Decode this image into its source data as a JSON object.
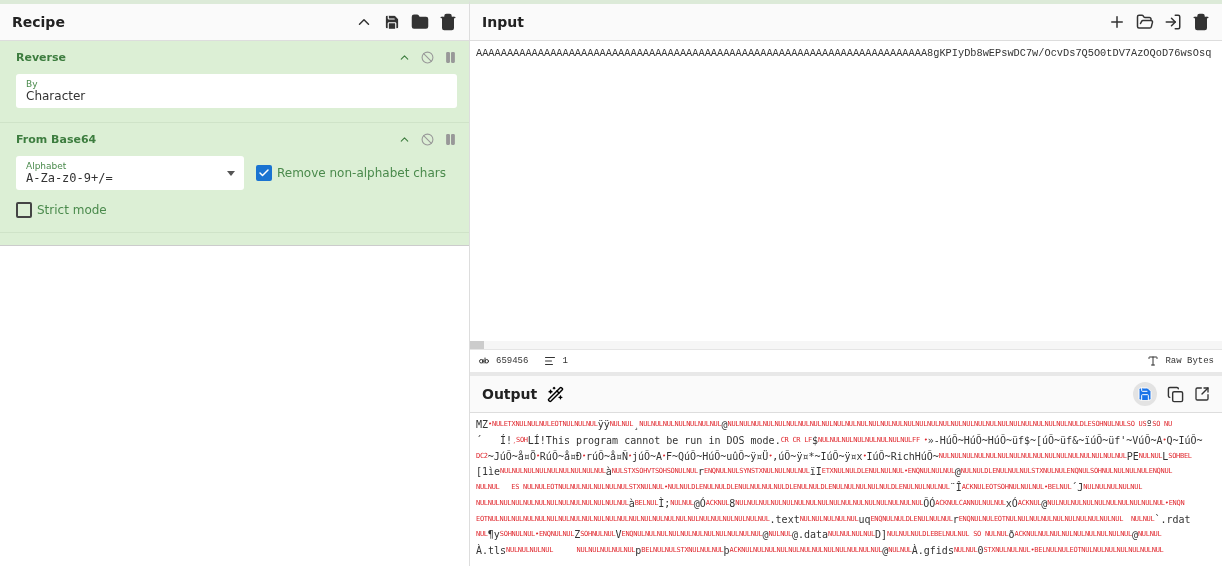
{
  "recipe": {
    "title": "Recipe",
    "operations": [
      {
        "name": "Reverse",
        "args": [
          {
            "kind": "text",
            "label": "By",
            "value": "Character"
          }
        ]
      },
      {
        "name": "From Base64",
        "args": [
          {
            "kind": "select",
            "label": "Alphabet",
            "value": "A-Za-z0-9+/="
          },
          {
            "kind": "checkbox",
            "label": "Remove non-alphabet chars",
            "checked": true
          },
          {
            "kind": "checkbox",
            "label": "Strict mode",
            "checked": false
          }
        ]
      }
    ]
  },
  "input": {
    "title": "Input",
    "value": "AAAAAAAAAAAAAAAAAAAAAAAAAAAAAAAAAAAAAAAAAAAAAAAAAAAAAAAAAAAAAAAAAAAAAAAAA8gKPIyDb8wEPswDC7w/OcvDs7Q5O0tDV7AzOQoD76wsOsq",
    "length": "659456",
    "lines": "1",
    "encoding": "Raw Bytes"
  },
  "output": {
    "title": "Output",
    "lines": [
      [
        {
          "kind": "text",
          "text": "MZ"
        },
        {
          "kind": "ctrl",
          "text": "•NULETXNULNULNULEOTNULNULNUL"
        },
        {
          "kind": "text",
          "text": "ÿÿ"
        },
        {
          "kind": "ctrl",
          "text": "NULNUL"
        },
        {
          "kind": "text",
          "text": "¸"
        },
        {
          "kind": "ctrl",
          "text": "NULNULNULNULNULNULNUL"
        },
        {
          "kind": "text",
          "text": "@"
        },
        {
          "kind": "ctrl",
          "text": "NULNULNULNULNULNULNULNULNULNULNULNULNULNULNULNULNULNULNULNULNULNULNULNULNULNULNULNULNULNULDLESOHNULNULSO US"
        },
        {
          "kind": "text",
          "text": "º"
        },
        {
          "kind": "ctrl",
          "text": "SO NU"
        }
      ],
      [
        {
          "kind": "text",
          "text": "´   Í!"
        },
        {
          "kind": "ctrl",
          "text": "¸SOH"
        },
        {
          "kind": "text",
          "text": "LÍ!This program cannot be run in DOS mode."
        },
        {
          "kind": "ctrl",
          "text": "CR CR LF"
        },
        {
          "kind": "text",
          "text": "$"
        },
        {
          "kind": "ctrl",
          "text": "NULNULNULNULNULNULNULNULFF •"
        },
        {
          "kind": "text",
          "text": "»-HúÕ~HúÕ~HúÕ~üf$~[úÕ~üf&~ïúÕ~üf'~VúÕ~A"
        },
        {
          "kind": "ctrl",
          "text": "•"
        },
        {
          "kind": "text",
          "text": "Q~IúÕ~"
        }
      ],
      [
        {
          "kind": "ctrl",
          "text": "DC2"
        },
        {
          "kind": "text",
          "text": "~JúÕ~å¤Ö"
        },
        {
          "kind": "ctrl",
          "text": "•"
        },
        {
          "kind": "text",
          "text": "RúÕ~å¤Ð"
        },
        {
          "kind": "ctrl",
          "text": "•"
        },
        {
          "kind": "text",
          "text": "rúÕ~å¤Ñ"
        },
        {
          "kind": "ctrl",
          "text": "•"
        },
        {
          "kind": "text",
          "text": "júÕ~A"
        },
        {
          "kind": "ctrl",
          "text": "•"
        },
        {
          "kind": "text",
          "text": "F~QúÕ~HúÕ~uûÕ~ÿ¤Ü"
        },
        {
          "kind": "ctrl",
          "text": "•"
        },
        {
          "kind": "text",
          "text": ",úÕ~ÿ¤*~IúÕ~ÿ¤x"
        },
        {
          "kind": "ctrl",
          "text": "•"
        },
        {
          "kind": "text",
          "text": "IúÕ~RichHúÕ~"
        },
        {
          "kind": "ctrl",
          "text": "NULNULNULNULNULNULNULNULNULNULNULNULNULNULNULNUL"
        },
        {
          "kind": "text",
          "text": "PE"
        },
        {
          "kind": "ctrl",
          "text": "NULNUL"
        },
        {
          "kind": "text",
          "text": "L"
        },
        {
          "kind": "ctrl",
          "text": "SOHBEL"
        }
      ],
      [
        {
          "kind": "text",
          "text": "[1ìe"
        },
        {
          "kind": "ctrl",
          "text": "NULNULNULNULNULNULNULNULNUL"
        },
        {
          "kind": "text",
          "text": "à"
        },
        {
          "kind": "ctrl",
          "text": "NULSTXSOHVTSOHSONULNUL"
        },
        {
          "kind": "text",
          "text": "r"
        },
        {
          "kind": "ctrl",
          "text": "ENQNULNULSYNSTXNULNULNULNUL"
        },
        {
          "kind": "text",
          "text": "ïI"
        },
        {
          "kind": "ctrl",
          "text": "ETXNULNULDLENULNULNUL•ENQNULNULNUL"
        },
        {
          "kind": "text",
          "text": "@"
        },
        {
          "kind": "ctrl",
          "text": "NULNULDLENULNULNULSTXNULNULENQNULSOHNULNULNULNULENQNUL"
        }
      ],
      [
        {
          "kind": "ctrl",
          "text": "NULNUL   ES NULNULEOTNULNULNULNULNULNULSTXNULNUL•NULNULDLENULNULDLENULNULNULNULDLENULNULDLENULNULNULNULNULDLENULNULNULNUL"
        },
        {
          "kind": "text",
          "text": "¨Î"
        },
        {
          "kind": "ctrl",
          "text": "ACKNULEOTSOHNULNULNUL•BELNUL"
        },
        {
          "kind": "text",
          "text": "´J"
        },
        {
          "kind": "ctrl",
          "text": "NULNULNULNULNUL"
        }
      ],
      [
        {
          "kind": "ctrl",
          "text": "NULNULNULNULNULNULNULNULNULNULNULNULNUL"
        },
        {
          "kind": "text",
          "text": "à"
        },
        {
          "kind": "ctrl",
          "text": "BELNUL"
        },
        {
          "kind": "text",
          "text": "Ì;"
        },
        {
          "kind": "ctrl",
          "text": "NULNUL"
        },
        {
          "kind": "text",
          "text": "@Ó"
        },
        {
          "kind": "ctrl",
          "text": "ACKNUL"
        },
        {
          "kind": "text",
          "text": "8"
        },
        {
          "kind": "ctrl",
          "text": "NULNULNULNULNULNULNULNULNULNULNULNULNULNULNULNUL"
        },
        {
          "kind": "text",
          "text": "ÕÓ"
        },
        {
          "kind": "ctrl",
          "text": "ACKNULCANNULNULNUL"
        },
        {
          "kind": "text",
          "text": "xÓ"
        },
        {
          "kind": "ctrl",
          "text": "ACKNUL"
        },
        {
          "kind": "text",
          "text": "@"
        },
        {
          "kind": "ctrl",
          "text": "NULNULNULNULNULNULNULNULNULNUL•ENQN"
        }
      ],
      [
        {
          "kind": "ctrl",
          "text": "EOTNULNULNULNULNULNULNULNULNULNULNULNULNULNULNULNULNULNULNULNULNULNULNULNUL"
        },
        {
          "kind": "text",
          "text": ".text"
        },
        {
          "kind": "ctrl",
          "text": "NULNULNULNULNUL"
        },
        {
          "kind": "text",
          "text": "uq"
        },
        {
          "kind": "ctrl",
          "text": "ENQNULNULDLENULNULNUL"
        },
        {
          "kind": "text",
          "text": "r"
        },
        {
          "kind": "ctrl",
          "text": "ENQNULNULEOTNULNULNULNULNULNULNULNULNULNUL  NULNUL"
        },
        {
          "kind": "text",
          "text": "`.rdat"
        }
      ],
      [
        {
          "kind": "ctrl",
          "text": "NUL"
        },
        {
          "kind": "text",
          "text": "¶y"
        },
        {
          "kind": "ctrl",
          "text": "SOHNULNUL•ENQNULNUL"
        },
        {
          "kind": "text",
          "text": "Z"
        },
        {
          "kind": "ctrl",
          "text": "SOHNULNUL"
        },
        {
          "kind": "text",
          "text": "V"
        },
        {
          "kind": "ctrl",
          "text": "ENQNULNULNULNULNULNULNULNULNULNULNUL"
        },
        {
          "kind": "text",
          "text": "@"
        },
        {
          "kind": "ctrl",
          "text": "NULNUL"
        },
        {
          "kind": "text",
          "text": "@.data"
        },
        {
          "kind": "ctrl",
          "text": "NULNULNULNUL"
        },
        {
          "kind": "text",
          "text": "D]"
        },
        {
          "kind": "ctrl",
          "text": "NULNULNULDLEBELNULNUL SO NULNUL"
        },
        {
          "kind": "text",
          "text": "ð"
        },
        {
          "kind": "ctrl",
          "text": "ACKNULNULNULNULNULNULNULNULNUL"
        },
        {
          "kind": "text",
          "text": "@"
        },
        {
          "kind": "ctrl",
          "text": "NULNUL"
        }
      ],
      [
        {
          "kind": "text",
          "text": "À.tls"
        },
        {
          "kind": "ctrl",
          "text": "NULNULNULNUL      NULNULNULNULNUL"
        },
        {
          "kind": "text",
          "text": "p"
        },
        {
          "kind": "ctrl",
          "text": "BELNULNULSTXNULNULNUL"
        },
        {
          "kind": "text",
          "text": "þ"
        },
        {
          "kind": "ctrl",
          "text": "ACKNULNULNULNULNULNULNULNULNULNULNULNUL"
        },
        {
          "kind": "text",
          "text": "@"
        },
        {
          "kind": "ctrl",
          "text": "NULNUL"
        },
        {
          "kind": "text",
          "text": "À.gfids"
        },
        {
          "kind": "ctrl",
          "text": "NULNUL"
        },
        {
          "kind": "text",
          "text": "0"
        },
        {
          "kind": "ctrl",
          "text": "STXNULNULNUL•BELNULNULEOTNULNULNULNULNULNULNUL"
        }
      ]
    ]
  }
}
